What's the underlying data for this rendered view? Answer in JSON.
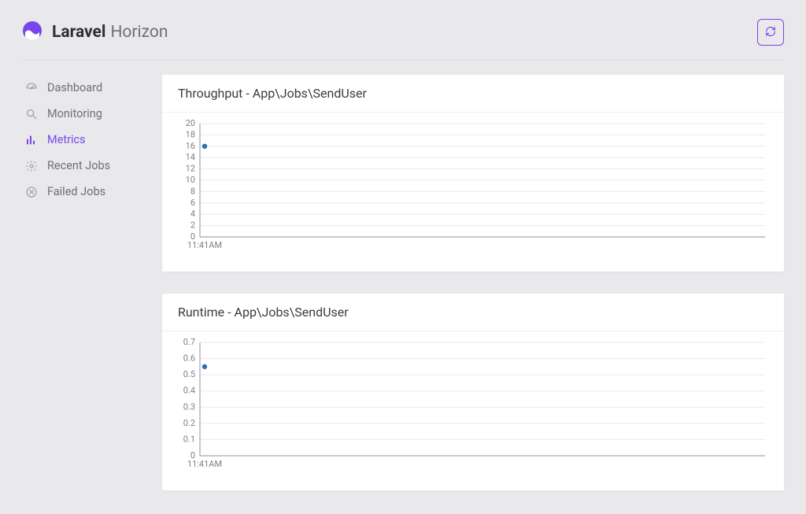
{
  "brand": {
    "bold": "Laravel",
    "light": "Horizon"
  },
  "sidebar": {
    "items": [
      {
        "label": "Dashboard",
        "icon": "gauge-icon",
        "active": false
      },
      {
        "label": "Monitoring",
        "icon": "search-icon",
        "active": false
      },
      {
        "label": "Metrics",
        "icon": "bars-icon",
        "active": true
      },
      {
        "label": "Recent Jobs",
        "icon": "gear-icon",
        "active": false
      },
      {
        "label": "Failed Jobs",
        "icon": "x-circle-icon",
        "active": false
      }
    ]
  },
  "cards": [
    {
      "title": "Throughput - App\\Jobs\\SendUser",
      "chart_key": "throughput"
    },
    {
      "title": "Runtime - App\\Jobs\\SendUser",
      "chart_key": "runtime"
    }
  ],
  "chart_data": [
    {
      "key": "throughput",
      "type": "line",
      "title": "Throughput - App\\Jobs\\SendUser",
      "x_categories": [
        "11:41AM"
      ],
      "series": [
        {
          "name": "throughput",
          "values": [
            16
          ]
        }
      ],
      "ylim": [
        0,
        20
      ],
      "yticks": [
        0,
        2,
        4,
        6,
        8,
        10,
        12,
        14,
        16,
        18,
        20
      ],
      "ylabel": "",
      "xlabel": ""
    },
    {
      "key": "runtime",
      "type": "line",
      "title": "Runtime - App\\Jobs\\SendUser",
      "x_categories": [
        "11:41AM"
      ],
      "series": [
        {
          "name": "runtime",
          "values": [
            0.55
          ]
        }
      ],
      "ylim": [
        0,
        0.7
      ],
      "yticks": [
        0,
        0.1,
        0.2,
        0.3,
        0.4,
        0.5,
        0.6,
        0.7
      ],
      "ylabel": "",
      "xlabel": ""
    }
  ],
  "colors": {
    "accent": "#7746ec",
    "point": "#2f6fb3",
    "grid": "#e8e9ee",
    "axis": "#8f919b"
  }
}
